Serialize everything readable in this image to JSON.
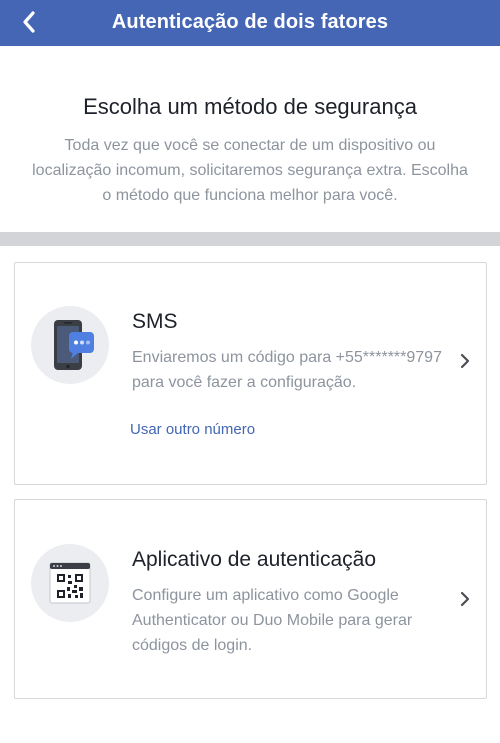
{
  "header": {
    "title": "Autenticação de dois fatores",
    "back_icon": "chevron-left-icon",
    "background": "#4466b4"
  },
  "intro": {
    "title": "Escolha um método de segurança",
    "description": "Toda vez que você se conectar de um dispositivo ou localização incomum, solicitaremos segurança extra. Escolha o método que funciona melhor para você."
  },
  "options": [
    {
      "title": "SMS",
      "description": "Enviaremos um código para +55*******9797 para você fazer a configuração.",
      "link": "Usar outro número",
      "icon": "phone-message-icon"
    },
    {
      "title": "Aplicativo de autenticação",
      "description": "Configure um aplicativo como Google Authenticator ou Duo Mobile para gerar códigos de login.",
      "icon": "qr-code-window-icon"
    }
  ],
  "colors": {
    "accent": "#4267b2",
    "muted_text": "#8d949e",
    "divider": "#d3d4d8"
  }
}
